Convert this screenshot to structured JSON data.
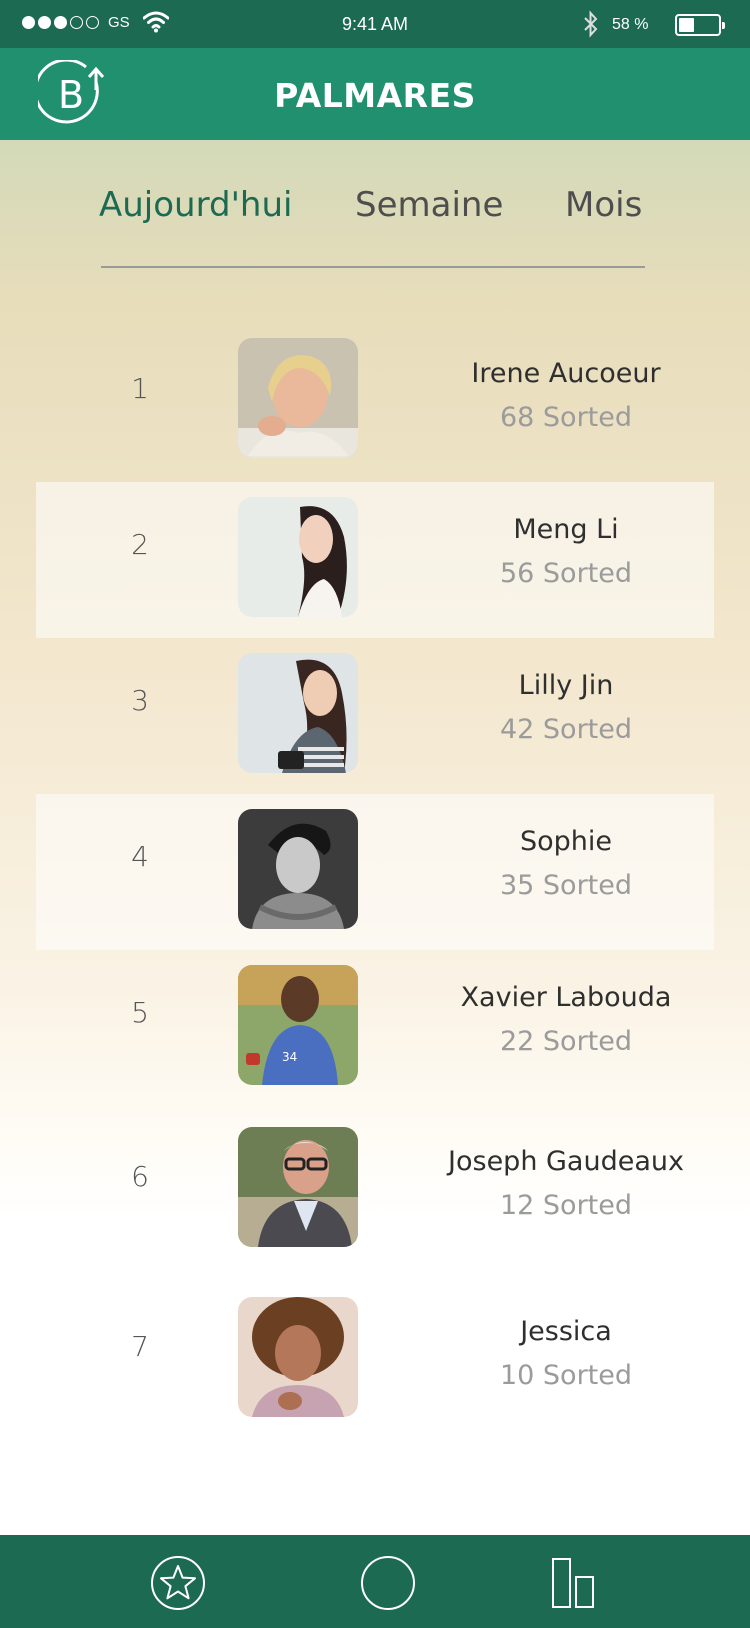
{
  "status_bar": {
    "signal_dots": [
      true,
      true,
      true,
      false,
      false
    ],
    "carrier": "GS",
    "time": "9:41 AM",
    "battery_percent": "58 %",
    "battery_level": 0.4
  },
  "header": {
    "logo_letter": "B",
    "title": "PALMARES"
  },
  "tabs": [
    {
      "label": "Aujourd'hui",
      "active": true
    },
    {
      "label": "Semaine",
      "active": false
    },
    {
      "label": "Mois",
      "active": false
    }
  ],
  "leaderboard": [
    {
      "rank": "1",
      "name": "Irene Aucoeur",
      "score": "68 Sorted"
    },
    {
      "rank": "2",
      "name": "Meng Li",
      "score": "56 Sorted"
    },
    {
      "rank": "3",
      "name": "Lilly Jin",
      "score": "42 Sorted"
    },
    {
      "rank": "4",
      "name": "Sophie",
      "score": "35 Sorted"
    },
    {
      "rank": "5",
      "name": "Xavier Labouda",
      "score": "22 Sorted"
    },
    {
      "rank": "6",
      "name": "Joseph Gaudeaux",
      "score": "12 Sorted"
    },
    {
      "rank": "7",
      "name": "Jessica",
      "score": "10 Sorted"
    }
  ],
  "bottom_nav": [
    {
      "icon": "star-icon"
    },
    {
      "icon": "circle-icon"
    },
    {
      "icon": "bar-chart-icon"
    }
  ],
  "colors": {
    "status_bar": "#1d6a52",
    "header": "#21906f",
    "active_tab": "#1d6a52",
    "bottom_bar": "#1d6a52"
  }
}
